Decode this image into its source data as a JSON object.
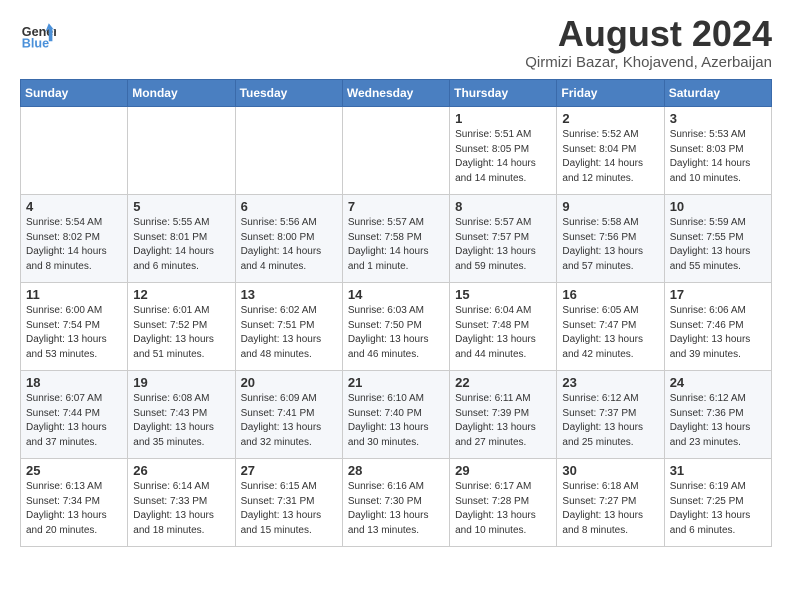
{
  "logo": {
    "line1": "General",
    "line2": "Blue"
  },
  "title": {
    "month": "August 2024",
    "location": "Qirmizi Bazar, Khojavend, Azerbaijan"
  },
  "weekdays": [
    "Sunday",
    "Monday",
    "Tuesday",
    "Wednesday",
    "Thursday",
    "Friday",
    "Saturday"
  ],
  "weeks": [
    [
      {
        "day": "",
        "info": ""
      },
      {
        "day": "",
        "info": ""
      },
      {
        "day": "",
        "info": ""
      },
      {
        "day": "",
        "info": ""
      },
      {
        "day": "1",
        "info": "Sunrise: 5:51 AM\nSunset: 8:05 PM\nDaylight: 14 hours\nand 14 minutes."
      },
      {
        "day": "2",
        "info": "Sunrise: 5:52 AM\nSunset: 8:04 PM\nDaylight: 14 hours\nand 12 minutes."
      },
      {
        "day": "3",
        "info": "Sunrise: 5:53 AM\nSunset: 8:03 PM\nDaylight: 14 hours\nand 10 minutes."
      }
    ],
    [
      {
        "day": "4",
        "info": "Sunrise: 5:54 AM\nSunset: 8:02 PM\nDaylight: 14 hours\nand 8 minutes."
      },
      {
        "day": "5",
        "info": "Sunrise: 5:55 AM\nSunset: 8:01 PM\nDaylight: 14 hours\nand 6 minutes."
      },
      {
        "day": "6",
        "info": "Sunrise: 5:56 AM\nSunset: 8:00 PM\nDaylight: 14 hours\nand 4 minutes."
      },
      {
        "day": "7",
        "info": "Sunrise: 5:57 AM\nSunset: 7:58 PM\nDaylight: 14 hours\nand 1 minute."
      },
      {
        "day": "8",
        "info": "Sunrise: 5:57 AM\nSunset: 7:57 PM\nDaylight: 13 hours\nand 59 minutes."
      },
      {
        "day": "9",
        "info": "Sunrise: 5:58 AM\nSunset: 7:56 PM\nDaylight: 13 hours\nand 57 minutes."
      },
      {
        "day": "10",
        "info": "Sunrise: 5:59 AM\nSunset: 7:55 PM\nDaylight: 13 hours\nand 55 minutes."
      }
    ],
    [
      {
        "day": "11",
        "info": "Sunrise: 6:00 AM\nSunset: 7:54 PM\nDaylight: 13 hours\nand 53 minutes."
      },
      {
        "day": "12",
        "info": "Sunrise: 6:01 AM\nSunset: 7:52 PM\nDaylight: 13 hours\nand 51 minutes."
      },
      {
        "day": "13",
        "info": "Sunrise: 6:02 AM\nSunset: 7:51 PM\nDaylight: 13 hours\nand 48 minutes."
      },
      {
        "day": "14",
        "info": "Sunrise: 6:03 AM\nSunset: 7:50 PM\nDaylight: 13 hours\nand 46 minutes."
      },
      {
        "day": "15",
        "info": "Sunrise: 6:04 AM\nSunset: 7:48 PM\nDaylight: 13 hours\nand 44 minutes."
      },
      {
        "day": "16",
        "info": "Sunrise: 6:05 AM\nSunset: 7:47 PM\nDaylight: 13 hours\nand 42 minutes."
      },
      {
        "day": "17",
        "info": "Sunrise: 6:06 AM\nSunset: 7:46 PM\nDaylight: 13 hours\nand 39 minutes."
      }
    ],
    [
      {
        "day": "18",
        "info": "Sunrise: 6:07 AM\nSunset: 7:44 PM\nDaylight: 13 hours\nand 37 minutes."
      },
      {
        "day": "19",
        "info": "Sunrise: 6:08 AM\nSunset: 7:43 PM\nDaylight: 13 hours\nand 35 minutes."
      },
      {
        "day": "20",
        "info": "Sunrise: 6:09 AM\nSunset: 7:41 PM\nDaylight: 13 hours\nand 32 minutes."
      },
      {
        "day": "21",
        "info": "Sunrise: 6:10 AM\nSunset: 7:40 PM\nDaylight: 13 hours\nand 30 minutes."
      },
      {
        "day": "22",
        "info": "Sunrise: 6:11 AM\nSunset: 7:39 PM\nDaylight: 13 hours\nand 27 minutes."
      },
      {
        "day": "23",
        "info": "Sunrise: 6:12 AM\nSunset: 7:37 PM\nDaylight: 13 hours\nand 25 minutes."
      },
      {
        "day": "24",
        "info": "Sunrise: 6:12 AM\nSunset: 7:36 PM\nDaylight: 13 hours\nand 23 minutes."
      }
    ],
    [
      {
        "day": "25",
        "info": "Sunrise: 6:13 AM\nSunset: 7:34 PM\nDaylight: 13 hours\nand 20 minutes."
      },
      {
        "day": "26",
        "info": "Sunrise: 6:14 AM\nSunset: 7:33 PM\nDaylight: 13 hours\nand 18 minutes."
      },
      {
        "day": "27",
        "info": "Sunrise: 6:15 AM\nSunset: 7:31 PM\nDaylight: 13 hours\nand 15 minutes."
      },
      {
        "day": "28",
        "info": "Sunrise: 6:16 AM\nSunset: 7:30 PM\nDaylight: 13 hours\nand 13 minutes."
      },
      {
        "day": "29",
        "info": "Sunrise: 6:17 AM\nSunset: 7:28 PM\nDaylight: 13 hours\nand 10 minutes."
      },
      {
        "day": "30",
        "info": "Sunrise: 6:18 AM\nSunset: 7:27 PM\nDaylight: 13 hours\nand 8 minutes."
      },
      {
        "day": "31",
        "info": "Sunrise: 6:19 AM\nSunset: 7:25 PM\nDaylight: 13 hours\nand 6 minutes."
      }
    ]
  ]
}
